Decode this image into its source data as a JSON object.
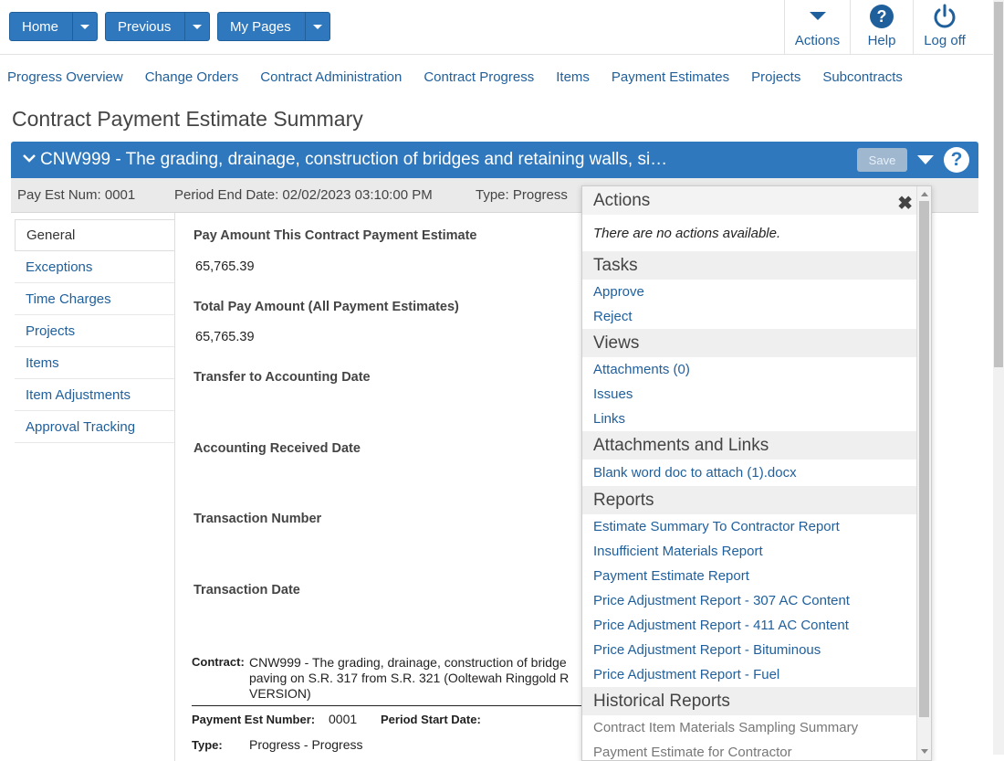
{
  "topnav": {
    "home": "Home",
    "previous": "Previous",
    "my_pages": "My Pages",
    "actions": "Actions",
    "help": "Help",
    "logoff": "Log off"
  },
  "mainnav": [
    "Progress Overview",
    "Change Orders",
    "Contract Administration",
    "Contract Progress",
    "Items",
    "Payment Estimates",
    "Projects",
    "Subcontracts"
  ],
  "page_title": "Contract Payment Estimate Summary",
  "header": {
    "title": "CNW999 - The grading, drainage, construction of bridges and retaining walls, si…",
    "save": "Save"
  },
  "info": {
    "pay_est_num": "Pay Est Num: 0001",
    "period_end": "Period End Date: 02/02/2023 03:10:00 PM",
    "type": "Type: Progress"
  },
  "sidebar": [
    "General",
    "Exceptions",
    "Time Charges",
    "Projects",
    "Items",
    "Item Adjustments",
    "Approval Tracking"
  ],
  "fields": {
    "pay_amount_label": "Pay Amount This Contract Payment Estimate",
    "pay_amount_value": "65,765.39",
    "total_pay_label": "Total Pay Amount (All Payment Estimates)",
    "total_pay_value": "65,765.39",
    "transfer_label": "Transfer to Accounting Date",
    "received_label": "Accounting Received Date",
    "txn_number_label": "Transaction Number",
    "txn_date_label": "Transaction Date"
  },
  "report": {
    "contract_label": "Contract:",
    "contract_line1": "CNW999 - The grading, drainage, construction of bridge",
    "contract_line2": "paving on S.R. 317 from S.R. 321 (Ooltewah Ringgold R",
    "contract_line3": "VERSION)",
    "payment_est_label": "Payment Est Number:",
    "payment_est_value": "0001",
    "period_start_label": "Period Start Date:",
    "type_label": "Type:",
    "type_value": "Progress - Progress"
  },
  "popup": {
    "actions_title": "Actions",
    "no_actions": "There are no actions available.",
    "tasks_title": "Tasks",
    "tasks": [
      "Approve",
      "Reject"
    ],
    "views_title": "Views",
    "views": [
      "Attachments (0)",
      "Issues",
      "Links"
    ],
    "attach_title": "Attachments and Links",
    "attach": [
      "Blank word doc to attach (1).docx"
    ],
    "reports_title": "Reports",
    "reports": [
      "Estimate Summary To Contractor Report",
      "Insufficient Materials Report",
      "Payment Estimate Report",
      "Price Adjustment Report - 307 AC Content",
      "Price Adjustment Report - 411 AC Content",
      "Price Adjustment Report - Bituminous",
      "Price Adjustment Report - Fuel"
    ],
    "historical_title": "Historical Reports",
    "historical": [
      "Contract Item Materials Sampling Summary",
      "Payment Estimate for Contractor"
    ]
  }
}
